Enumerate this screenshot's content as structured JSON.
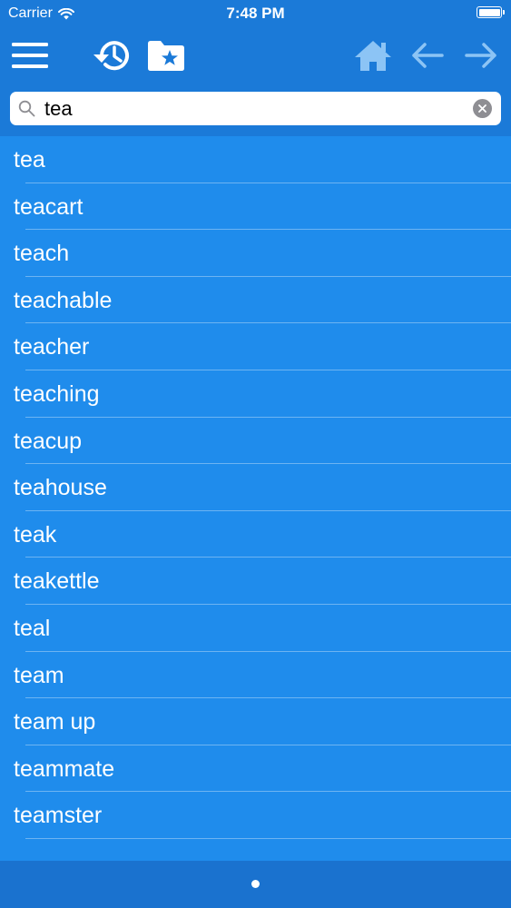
{
  "status_bar": {
    "carrier": "Carrier",
    "time": "7:48 PM"
  },
  "toolbar": {
    "icons": [
      "menu-icon",
      "history-icon",
      "favorites-folder-icon",
      "home-icon",
      "back-arrow-icon",
      "forward-arrow-icon"
    ]
  },
  "search": {
    "value": "tea",
    "placeholder": ""
  },
  "word_list": {
    "items": [
      {
        "label": "tea"
      },
      {
        "label": "teacart"
      },
      {
        "label": "teach"
      },
      {
        "label": "teachable"
      },
      {
        "label": "teacher"
      },
      {
        "label": "teaching"
      },
      {
        "label": "teacup"
      },
      {
        "label": "teahouse"
      },
      {
        "label": "teak"
      },
      {
        "label": "teakettle"
      },
      {
        "label": "teal"
      },
      {
        "label": "team"
      },
      {
        "label": "team up"
      },
      {
        "label": "teammate"
      },
      {
        "label": "teamster"
      }
    ]
  },
  "colors": {
    "header": "#1b7ad8",
    "list_background": "#1f8cec",
    "bottom_bar": "#1a72cf",
    "disabled_icon": "#8cc4f5"
  }
}
